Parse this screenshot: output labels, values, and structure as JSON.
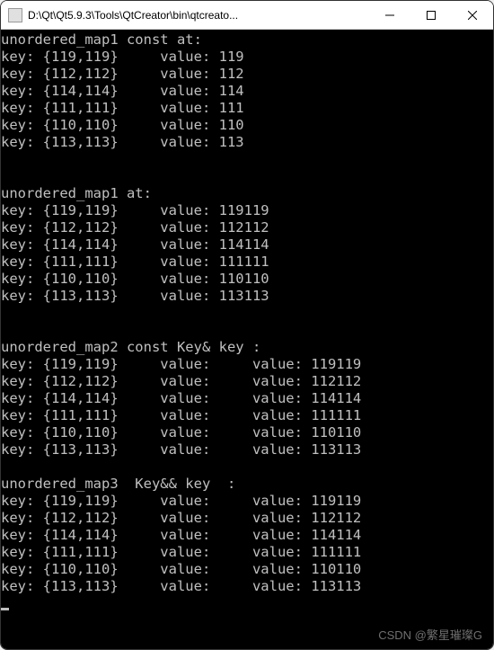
{
  "window": {
    "title": "D:\\Qt\\Qt5.9.3\\Tools\\QtCreator\\bin\\qtcreato..."
  },
  "watermark": "CSDN @繁星璀璨G",
  "sections": [
    {
      "header": "unordered_map1 const at:",
      "rows": [
        {
          "key": "{119,119}",
          "value": "119"
        },
        {
          "key": "{112,112}",
          "value": "112"
        },
        {
          "key": "{114,114}",
          "value": "114"
        },
        {
          "key": "{111,111}",
          "value": "111"
        },
        {
          "key": "{110,110}",
          "value": "110"
        },
        {
          "key": "{113,113}",
          "value": "113"
        }
      ],
      "blanks_after": 2
    },
    {
      "header": "unordered_map1 at:",
      "rows": [
        {
          "key": "{119,119}",
          "value": "119119"
        },
        {
          "key": "{112,112}",
          "value": "112112"
        },
        {
          "key": "{114,114}",
          "value": "114114"
        },
        {
          "key": "{111,111}",
          "value": "111111"
        },
        {
          "key": "{110,110}",
          "value": "110110"
        },
        {
          "key": "{113,113}",
          "value": "113113"
        }
      ],
      "blanks_after": 2
    },
    {
      "header": "unordered_map2 const Key& key :",
      "rows": [
        {
          "key": "{119,119}",
          "value": "",
          "value2": "119119"
        },
        {
          "key": "{112,112}",
          "value": "",
          "value2": "112112"
        },
        {
          "key": "{114,114}",
          "value": "",
          "value2": "114114"
        },
        {
          "key": "{111,111}",
          "value": "",
          "value2": "111111"
        },
        {
          "key": "{110,110}",
          "value": "",
          "value2": "110110"
        },
        {
          "key": "{113,113}",
          "value": "",
          "value2": "113113"
        }
      ],
      "blanks_after": 1
    },
    {
      "header": "unordered_map3  Key&& key  :",
      "rows": [
        {
          "key": "{119,119}",
          "value": "",
          "value2": "119119"
        },
        {
          "key": "{112,112}",
          "value": "",
          "value2": "112112"
        },
        {
          "key": "{114,114}",
          "value": "",
          "value2": "114114"
        },
        {
          "key": "{111,111}",
          "value": "",
          "value2": "111111"
        },
        {
          "key": "{110,110}",
          "value": "",
          "value2": "110110"
        },
        {
          "key": "{113,113}",
          "value": "",
          "value2": "113113"
        }
      ],
      "blanks_after": 0
    }
  ],
  "labels": {
    "key_prefix": "key: ",
    "value_prefix": "value: "
  }
}
